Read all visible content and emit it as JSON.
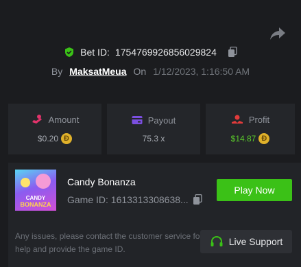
{
  "bet": {
    "label": "Bet ID:",
    "id": "1754769926856029824"
  },
  "byline": {
    "by": "By",
    "user": "MaksatMeua",
    "on": "On",
    "date": "1/12/2023, 1:16:50 AM"
  },
  "stats": [
    {
      "label": "Amount",
      "value": "$0.20",
      "coin": "Ð"
    },
    {
      "label": "Payout",
      "value": "75.3 x"
    },
    {
      "label": "Profit",
      "value": "$14.87",
      "coin": "Ð"
    }
  ],
  "game": {
    "thumb_line1": "CANDY",
    "thumb_line2": "BONANZA",
    "title": "Candy Bonanza",
    "id_text": "Game ID: 1613313308638...",
    "play_label": "Play Now",
    "note": "Any issues, please contact the customer service for help and provide the game ID.",
    "support_label": "Live Support"
  },
  "colors": {
    "accent": "#3bc117",
    "profit": "#5acb2a",
    "coin": "#e0b12a",
    "background": "#1b1c1f"
  }
}
